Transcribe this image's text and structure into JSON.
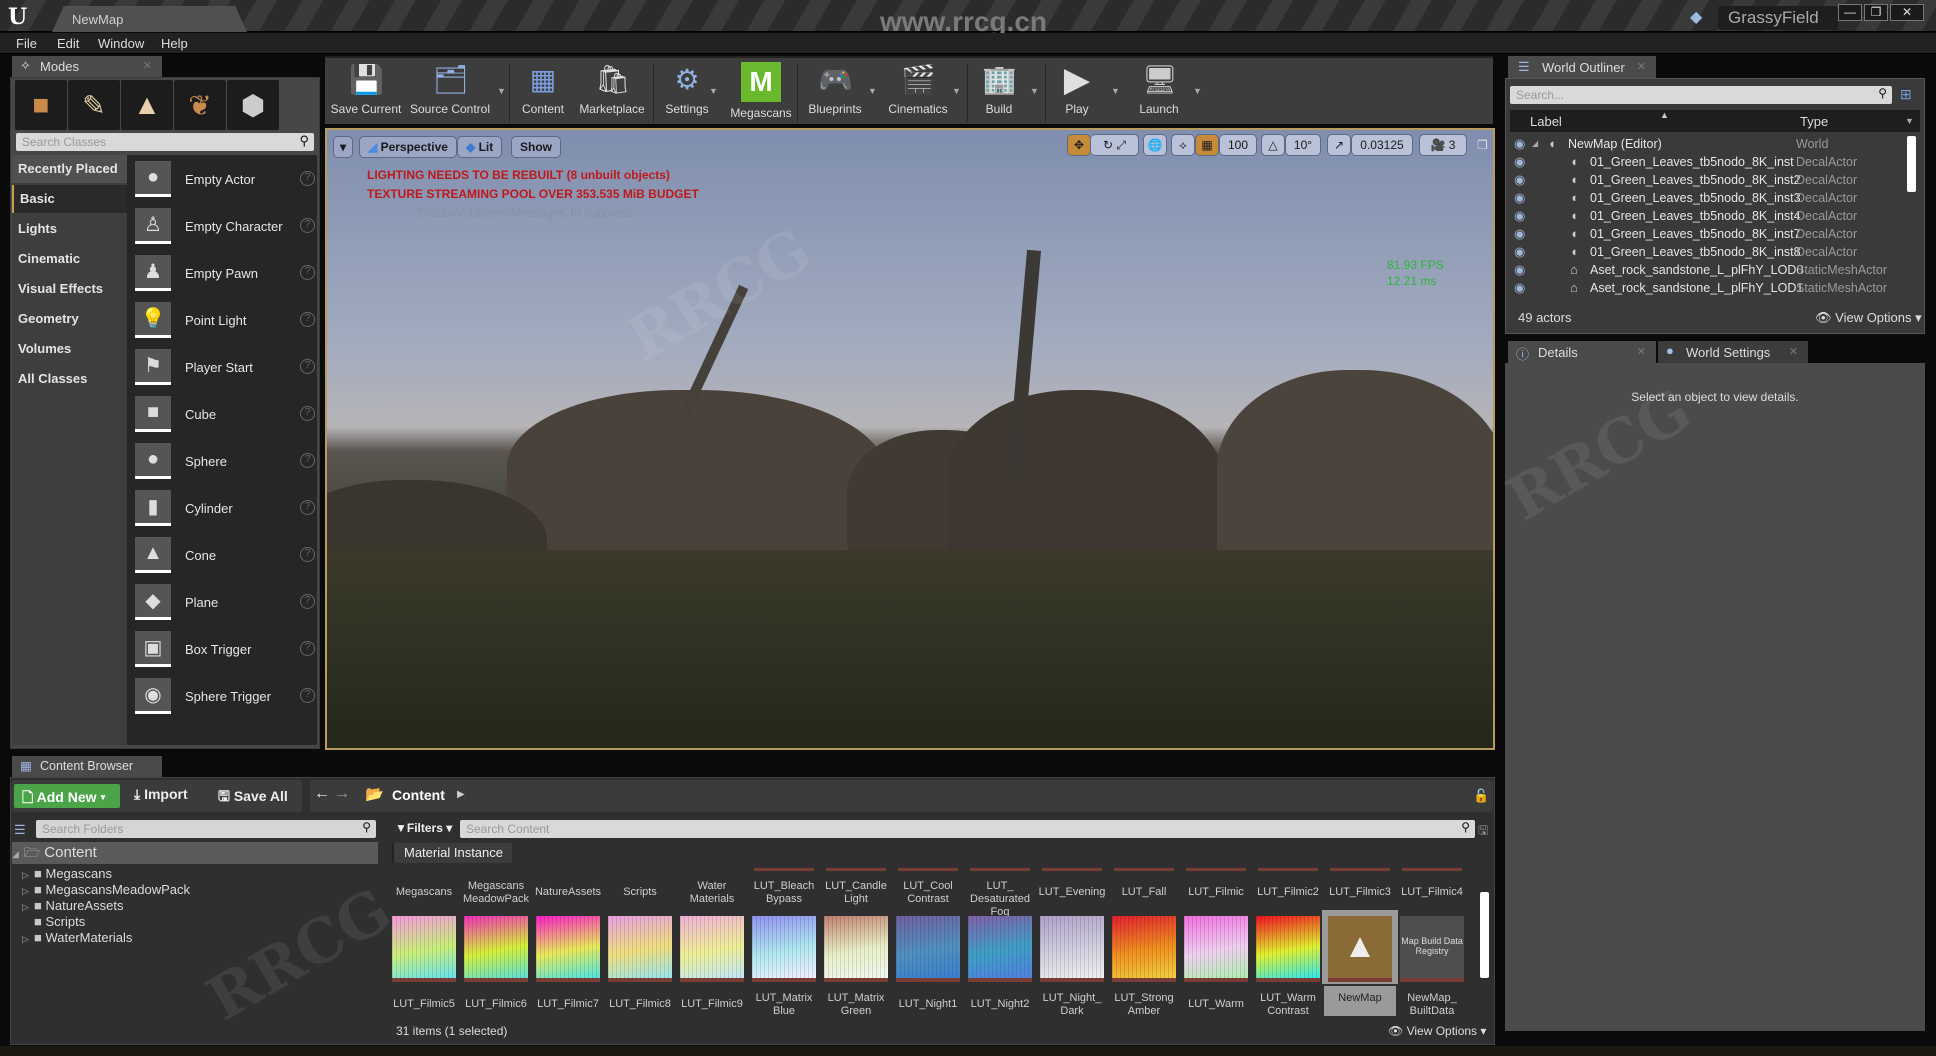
{
  "window": {
    "document_tab": "NewMap",
    "watermark_url": "www.rrcg.cn",
    "project_name": "GrassyField",
    "controls": {
      "minimize": "—",
      "maximize": "❐",
      "close": "✕"
    }
  },
  "menu": [
    "File",
    "Edit",
    "Window",
    "Help"
  ],
  "modes": {
    "tab_label": "Modes",
    "mode_buttons": [
      {
        "name": "place-mode",
        "icon": "cube-bulb-icon"
      },
      {
        "name": "paint-mode",
        "icon": "brush-icon"
      },
      {
        "name": "landscape-mode",
        "icon": "mountain-icon"
      },
      {
        "name": "foliage-mode",
        "icon": "leaf-icon"
      },
      {
        "name": "geometry-mode",
        "icon": "geometry-cube-icon"
      }
    ],
    "search_placeholder": "Search Classes",
    "categories": [
      "Recently Placed",
      "Basic",
      "Lights",
      "Cinematic",
      "Visual Effects",
      "Geometry",
      "Volumes",
      "All Classes"
    ],
    "active_category": "Basic",
    "classes": [
      {
        "label": "Empty Actor",
        "icon": "sphere-icon"
      },
      {
        "label": "Empty Character",
        "icon": "character-icon"
      },
      {
        "label": "Empty Pawn",
        "icon": "pawn-icon"
      },
      {
        "label": "Point Light",
        "icon": "light-bulb-icon"
      },
      {
        "label": "Player Start",
        "icon": "player-start-icon"
      },
      {
        "label": "Cube",
        "icon": "cube-icon"
      },
      {
        "label": "Sphere",
        "icon": "sphere-icon"
      },
      {
        "label": "Cylinder",
        "icon": "cylinder-icon"
      },
      {
        "label": "Cone",
        "icon": "cone-icon"
      },
      {
        "label": "Plane",
        "icon": "plane-icon"
      },
      {
        "label": "Box Trigger",
        "icon": "box-trigger-icon"
      },
      {
        "label": "Sphere Trigger",
        "icon": "sphere-trigger-icon"
      }
    ]
  },
  "toolbar": {
    "buttons": [
      {
        "label": "Save Current",
        "icon": "💾",
        "dropdown": false
      },
      {
        "label": "Source Control",
        "icon": "🗂",
        "dropdown": true
      },
      {
        "label": "Content",
        "icon": "▦",
        "dropdown": false
      },
      {
        "label": "Marketplace",
        "icon": "🛍",
        "dropdown": false
      },
      {
        "label": "Settings",
        "icon": "⚙",
        "dropdown": true
      },
      {
        "label": "Megascans",
        "icon": "M",
        "dropdown": false
      },
      {
        "label": "Blueprints",
        "icon": "🎮",
        "dropdown": true
      },
      {
        "label": "Cinematics",
        "icon": "🎬",
        "dropdown": true
      },
      {
        "label": "Build",
        "icon": "🏢",
        "dropdown": true
      },
      {
        "label": "Play",
        "icon": "▶",
        "dropdown": true
      },
      {
        "label": "Launch",
        "icon": "🖥",
        "dropdown": true
      }
    ]
  },
  "viewport": {
    "options_dropdown": "▾",
    "view_mode": "Perspective",
    "lighting": "Lit",
    "show": "Show",
    "grid_snap": "100",
    "rotation_snap": "10°",
    "scale_snap": "0.03125",
    "camera_speed": "3",
    "messages": [
      "LIGHTING NEEDS TO BE REBUILT (8 unbuilt objects)",
      "TEXTURE STREAMING POOL OVER 353.535 MiB BUDGET"
    ],
    "suppress_hint": "'DisableAllScreenMessages' to suppress",
    "fps": "81.93 FPS",
    "frame_ms": "12.21 ms"
  },
  "outliner": {
    "tab_label": "World Outliner",
    "search_placeholder": "Search...",
    "columns": {
      "label": "Label",
      "type": "Type"
    },
    "rows": [
      {
        "name": "NewMap (Editor)",
        "type": "World",
        "level": 0
      },
      {
        "name": "01_Green_Leaves_tb5nodo_8K_inst",
        "type": "DecalActor",
        "level": 1
      },
      {
        "name": "01_Green_Leaves_tb5nodo_8K_inst2",
        "type": "DecalActor",
        "level": 1
      },
      {
        "name": "01_Green_Leaves_tb5nodo_8K_inst3",
        "type": "DecalActor",
        "level": 1
      },
      {
        "name": "01_Green_Leaves_tb5nodo_8K_inst4",
        "type": "DecalActor",
        "level": 1
      },
      {
        "name": "01_Green_Leaves_tb5nodo_8K_inst7",
        "type": "DecalActor",
        "level": 1
      },
      {
        "name": "01_Green_Leaves_tb5nodo_8K_inst8",
        "type": "DecalActor",
        "level": 1
      },
      {
        "name": "Aset_rock_sandstone_L_plFhY_LOD0",
        "type": "StaticMeshActor",
        "level": 1
      },
      {
        "name": "Aset_rock_sandstone_L_plFhY_LOD1",
        "type": "StaticMeshActor",
        "level": 1
      }
    ],
    "actor_count": "49 actors",
    "view_options": "View Options"
  },
  "details": {
    "tabs": [
      "Details",
      "World Settings"
    ],
    "empty_message": "Select an object to view details."
  },
  "content_browser": {
    "tab_label": "Content Browser",
    "add_new": "Add New",
    "import": "Import",
    "save_all": "Save All",
    "path": "Content",
    "folder_search_placeholder": "Search Folders",
    "tree_root": "Content",
    "folders": [
      {
        "name": "Megascans",
        "expandable": true
      },
      {
        "name": "MegascansMeadowPack",
        "expandable": true
      },
      {
        "name": "NatureAssets",
        "expandable": true
      },
      {
        "name": "Scripts",
        "expandable": false
      },
      {
        "name": "WaterMaterials",
        "expandable": true
      }
    ],
    "filters_label": "Filters",
    "content_search_placeholder": "Search Content",
    "active_filter": "Material Instance",
    "row1": [
      {
        "label": "Megascans",
        "kind": "folder"
      },
      {
        "label": "Megascans MeadowPack",
        "kind": "folder"
      },
      {
        "label": "NatureAssets",
        "kind": "folder"
      },
      {
        "label": "Scripts",
        "kind": "folder"
      },
      {
        "label": "Water Materials",
        "kind": "folder"
      },
      {
        "label": "LUT_Bleach Bypass",
        "kind": "lut"
      },
      {
        "label": "LUT_Candle Light",
        "kind": "lut"
      },
      {
        "label": "LUT_Cool Contrast",
        "kind": "lut"
      },
      {
        "label": "LUT_ Desaturated Fog",
        "kind": "lut"
      },
      {
        "label": "LUT_Evening",
        "kind": "lut"
      },
      {
        "label": "LUT_Fall",
        "kind": "lut"
      },
      {
        "label": "LUT_Filmic",
        "kind": "lut"
      },
      {
        "label": "LUT_Filmic2",
        "kind": "lut"
      },
      {
        "label": "LUT_Filmic3",
        "kind": "lut"
      },
      {
        "label": "LUT_Filmic4",
        "kind": "lut"
      }
    ],
    "row2": [
      {
        "label": "LUT_Filmic5",
        "colors": [
          "#f59adc",
          "#c9f07a",
          "#6ae2f0"
        ]
      },
      {
        "label": "LUT_Filmic6",
        "colors": [
          "#f02fb8",
          "#d6f03a",
          "#5ae0d8"
        ]
      },
      {
        "label": "LUT_Filmic7",
        "colors": [
          "#f91ec8",
          "#e9e95a",
          "#4ce6e6"
        ]
      },
      {
        "label": "LUT_Filmic8",
        "colors": [
          "#e8a0e0",
          "#f0e080",
          "#9ae4f0"
        ]
      },
      {
        "label": "LUT_Filmic9",
        "colors": [
          "#f0b0d8",
          "#f0f098",
          "#c0e8f8"
        ]
      },
      {
        "label": "LUT_Matrix Blue",
        "colors": [
          "#9090f0",
          "#b0e8f0",
          "#f0f0ff"
        ]
      },
      {
        "label": "LUT_Matrix Green",
        "colors": [
          "#c08070",
          "#e8f0c8",
          "#f0f8f0"
        ]
      },
      {
        "label": "LUT_Night1",
        "colors": [
          "#7060a0",
          "#5090c0",
          "#3a80d0"
        ]
      },
      {
        "label": "LUT_Night2",
        "colors": [
          "#8060a8",
          "#40a0c8",
          "#5080e0"
        ]
      },
      {
        "label": "LUT_Night_ Dark",
        "colors": [
          "#b0a0c8",
          "#d0d0e0",
          "#f0f0f0"
        ]
      },
      {
        "label": "LUT_Strong Amber",
        "colors": [
          "#e02030",
          "#f09020",
          "#f0d040"
        ]
      },
      {
        "label": "LUT_Warm",
        "colors": [
          "#f070e0",
          "#f0d0f0",
          "#b0f0b0"
        ]
      },
      {
        "label": "LUT_Warm Contrast",
        "colors": [
          "#f01020",
          "#e0f030",
          "#30e8f0"
        ]
      },
      {
        "label": "NewMap",
        "kind": "level",
        "selected": true
      },
      {
        "label": "NewMap_ BuiltData",
        "kind": "registry",
        "thumb_text": "Map Build Data Registry"
      }
    ],
    "item_count": "31 items (1 selected)",
    "view_options": "View Options"
  },
  "colors": {
    "accent_green": "#4ba448",
    "viewport_border": "#b89b5e",
    "warning_red": "#c0181a",
    "fps_green": "#2cb73a",
    "megascans_green": "#6ab82e"
  }
}
